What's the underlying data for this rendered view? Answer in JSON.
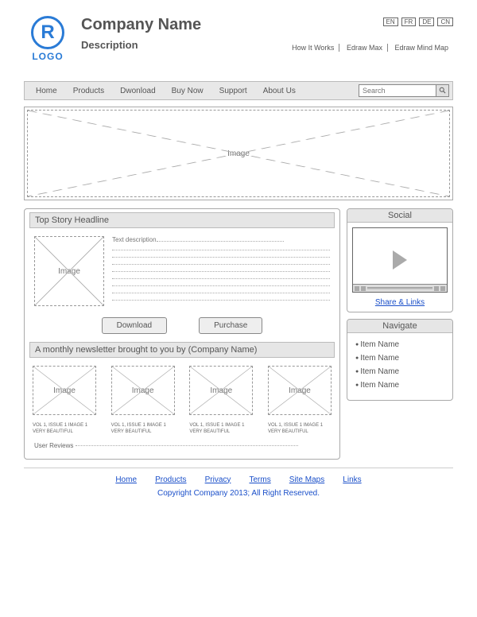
{
  "header": {
    "logo_text": "LOGO",
    "badge_letter": "R",
    "company_name": "Company Name",
    "description": "Description",
    "languages": [
      "EN",
      "FR",
      "DE",
      "CN"
    ],
    "top_links": [
      "How It Works",
      "Edraw Max",
      "Edraw Mind Map"
    ]
  },
  "nav": {
    "items": [
      "Home",
      "Products",
      "Dwonload",
      "Buy Now",
      "Support",
      "About Us"
    ],
    "search_placeholder": "Search"
  },
  "hero": {
    "label": "Image"
  },
  "story": {
    "headline": "Top Story Headline",
    "image_label": "Image",
    "text_label": "Text description",
    "download_btn": "Download",
    "purchase_btn": "Purchase"
  },
  "newsletter": {
    "title": "A monthly newsletter brought to you by (Company Name)",
    "cards": [
      {
        "label": "Image",
        "caption": "VOL 1, ISSUE 1 IMAGE 1 VERY BEAUTIFUL"
      },
      {
        "label": "Image",
        "caption": "VOL 1, ISSUE 1 IMAGE 1 VERY BEAUTIFUL"
      },
      {
        "label": "Image",
        "caption": "VOL 1, ISSUE 1 IMAGE 1 VERY BEAUTIFUL"
      },
      {
        "label": "Image",
        "caption": "VOL 1, ISSUE 1 IMAGE 1 VERY BEAUTIFUL"
      }
    ],
    "reviews_label": "User Reviews"
  },
  "sidebar": {
    "social_title": "Social",
    "share_label": "Share & Links",
    "navigate_title": "Navigate",
    "nav_items": [
      "Item Name",
      "Item Name",
      "Item Name",
      "Item Name"
    ]
  },
  "footer": {
    "links": [
      "Home",
      "Products",
      "Privacy",
      "Terms",
      "Site Maps",
      "Links"
    ],
    "copyright": "Copyright Company 2013; All Right Reserved."
  }
}
